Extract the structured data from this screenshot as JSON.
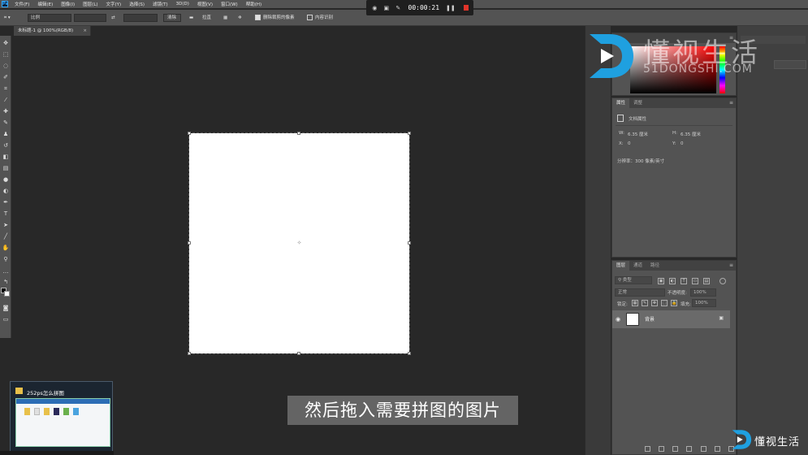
{
  "menu": {
    "items": [
      "文件(F)",
      "编辑(E)",
      "图像(I)",
      "图层(L)",
      "文字(Y)",
      "选择(S)",
      "滤镜(T)",
      "3D(D)",
      "视图(V)",
      "窗口(W)",
      "帮助(H)"
    ]
  },
  "options": {
    "ratio_label": "比例",
    "swap_icon": "⇄",
    "clear_label": "清除",
    "straighten_label": "拉直",
    "delete_cropped_label": "删除裁剪的像素",
    "content_aware_label": "内容识别"
  },
  "recorder": {
    "time": "00:00:21"
  },
  "document": {
    "tab_title": "未标题-1 @ 100%(RGB/8)"
  },
  "properties": {
    "tabs": [
      "属性",
      "调整"
    ],
    "section_label": "文档属性",
    "w_label": "W:",
    "w_value": "6.35 厘米",
    "h_label": "H:",
    "h_value": "6.35 厘米",
    "x_label": "X:",
    "x_value": "0",
    "y_label": "Y:",
    "y_value": "0",
    "resolution": "分辨率：300 像素/英寸"
  },
  "layers": {
    "tabs": [
      "图层",
      "通道",
      "路径"
    ],
    "kind_filter": "类型",
    "blend_mode": "正常",
    "opacity_label": "不透明度:",
    "opacity_value": "100%",
    "lock_label": "锁定:",
    "fill_label": "填充:",
    "fill_value": "100%",
    "layer_name": "背景"
  },
  "watermark": {
    "title": "懂视生活",
    "subtitle": "51DONGSHI.COM"
  },
  "taskbar": {
    "window_title": "252ps怎么拼图"
  },
  "subtitle": "然后拖入需要拼图的图片",
  "footer_logo": "懂视生活",
  "colors": {
    "accent": "#31a8ff",
    "logo_blue": "#1fa0e0",
    "record_red": "#e0342a"
  }
}
